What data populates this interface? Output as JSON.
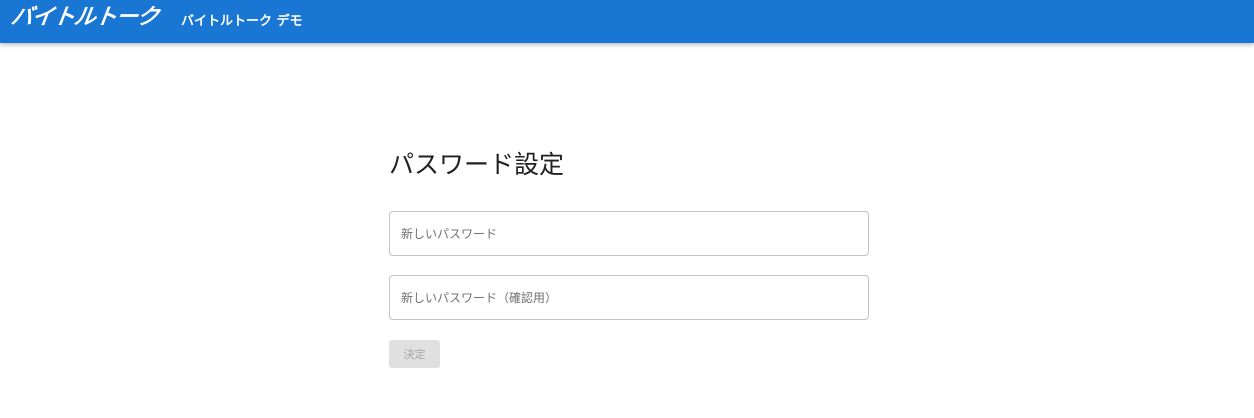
{
  "header": {
    "logo_text": "バイトルトーク",
    "app_title": "バイトルトーク デモ",
    "bg_color": "#1976d2"
  },
  "main": {
    "title": "パスワード設定",
    "new_password": {
      "placeholder": "新しいパスワード",
      "value": ""
    },
    "confirm_password": {
      "placeholder": "新しいパスワード（確認用）",
      "value": ""
    },
    "submit_label": "決定",
    "submit_disabled": true
  }
}
